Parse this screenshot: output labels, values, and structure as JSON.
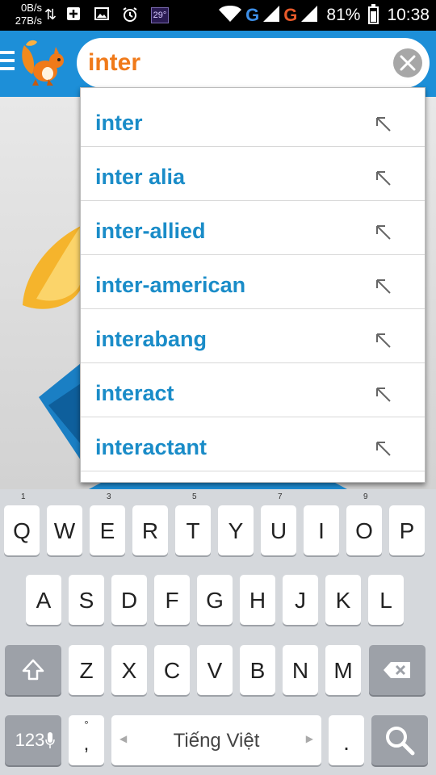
{
  "status_bar": {
    "upload_speed": "0B/s",
    "download_speed": "27B/s",
    "temperature": "29°",
    "network_1": "G",
    "network_2": "G",
    "battery_percent": "81%",
    "battery_level": 0.81,
    "time": "10:38"
  },
  "search": {
    "value": "inter",
    "placeholder": ""
  },
  "suggestions": [
    {
      "text": "inter"
    },
    {
      "text": "inter alia"
    },
    {
      "text": "inter-allied"
    },
    {
      "text": "inter-american"
    },
    {
      "text": "interabang"
    },
    {
      "text": "interact"
    },
    {
      "text": "interactant"
    }
  ],
  "keyboard": {
    "row1": [
      {
        "label": "Q",
        "hint": "1"
      },
      {
        "label": "W",
        "hint": ""
      },
      {
        "label": "E",
        "hint": "3"
      },
      {
        "label": "R",
        "hint": ""
      },
      {
        "label": "T",
        "hint": "5"
      },
      {
        "label": "Y",
        "hint": ""
      },
      {
        "label": "U",
        "hint": "7"
      },
      {
        "label": "I",
        "hint": ""
      },
      {
        "label": "O",
        "hint": "9"
      },
      {
        "label": "P",
        "hint": ""
      }
    ],
    "row2": [
      "A",
      "S",
      "D",
      "F",
      "G",
      "H",
      "J",
      "K",
      "L"
    ],
    "row3": [
      "Z",
      "X",
      "C",
      "V",
      "B",
      "N",
      "M"
    ],
    "numbers_label": "123",
    "comma_label": ",",
    "comma_hint": "°",
    "space_label": "Tiếng Việt",
    "period_label": "."
  },
  "colors": {
    "app_bar": "#1d8fd8",
    "search_text": "#f07a1a",
    "suggestion_text": "#1a8cc8"
  }
}
